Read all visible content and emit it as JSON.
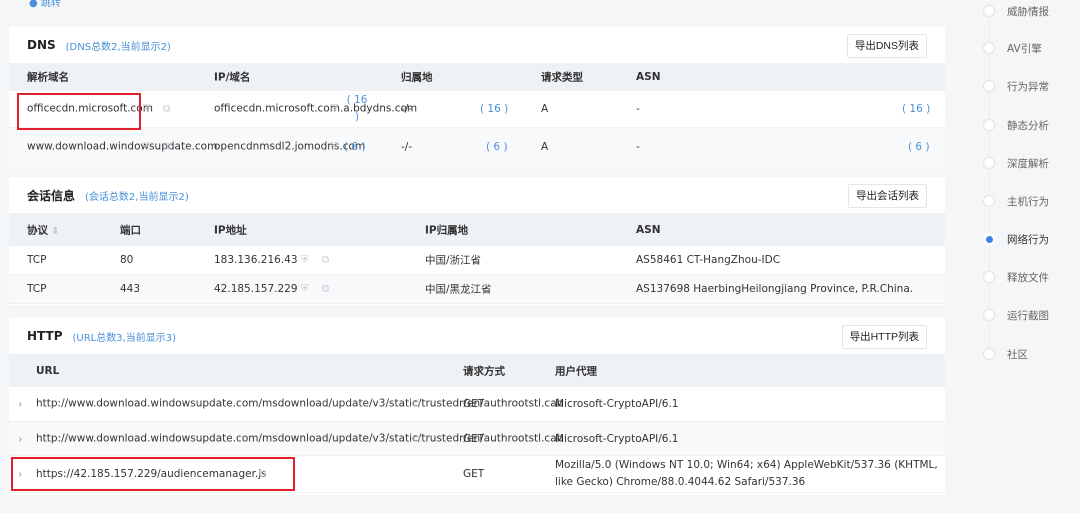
{
  "top_link": "● 跳转",
  "dns": {
    "title": "DNS",
    "subtitle": "(DNS总数2,当前显示2)",
    "export": "导出DNS列表",
    "headers": [
      "解析域名",
      "IP/域名",
      "归属地",
      "请求类型",
      "ASN"
    ],
    "rows": [
      {
        "domain": "officecdn.microsoft.com",
        "ip": "officecdn.microsoft.com.a.bdydns.com",
        "ip_count": "( 16 )",
        "location": "-/-",
        "loc_count": "( 16 )",
        "type": "A",
        "asn": "-",
        "asn_count": "( 16 )"
      },
      {
        "domain": "www.download.windowsupdate.com",
        "ip": "opencdnmsdl2.jomodns.com",
        "ip_count": "( 6 )",
        "location": "-/-",
        "loc_count": "( 6 )",
        "type": "A",
        "asn": "-",
        "asn_count": "( 6 )"
      }
    ]
  },
  "session": {
    "title": "会话信息",
    "subtitle": "(会话总数2,当前显示2)",
    "export": "导出会话列表",
    "headers": [
      "协议",
      "端口",
      "IP地址",
      "IP归属地",
      "ASN"
    ],
    "rows": [
      {
        "proto": "TCP",
        "port": "80",
        "ip": "183.136.216.43",
        "loc": "中国/浙江省",
        "asn": "AS58461 CT-HangZhou-IDC"
      },
      {
        "proto": "TCP",
        "port": "443",
        "ip": "42.185.157.229",
        "loc": "中国/黑龙江省",
        "asn": "AS137698 HaerbingHeilongjiang Province, P.R.China."
      }
    ]
  },
  "http": {
    "title": "HTTP",
    "subtitle": "(URL总数3,当前显示3)",
    "export": "导出HTTP列表",
    "headers": [
      "URL",
      "请求方式",
      "用户代理"
    ],
    "rows": [
      {
        "url": "http://www.download.windowsupdate.com/msdownload/update/v3/static/trustedr/en/authrootstl.cab",
        "method": "GET",
        "ua": "Microsoft-CryptoAPI/6.1"
      },
      {
        "url": "http://www.download.windowsupdate.com/msdownload/update/v3/static/trustedr/en/authrootstl.cab",
        "method": "GET",
        "ua": "Microsoft-CryptoAPI/6.1"
      },
      {
        "url": "https://42.185.157.229/audiencemanager.js",
        "method": "GET",
        "ua": "Mozilla/5.0 (Windows NT 10.0; Win64; x64) AppleWebKit/537.36 (KHTML, like Gecko) Chrome/88.0.4044.62 Safari/537.36"
      }
    ]
  },
  "sidebar": {
    "items": [
      "威胁情报",
      "AV引擎",
      "行为异常",
      "静态分析",
      "深度解析",
      "主机行为",
      "网络行为",
      "释放文件",
      "运行截图",
      "社区"
    ],
    "active": "网络行为"
  },
  "colors": {
    "accent": "#3b82e6",
    "highlight": "#e0212b",
    "link": "#4a90d9"
  }
}
